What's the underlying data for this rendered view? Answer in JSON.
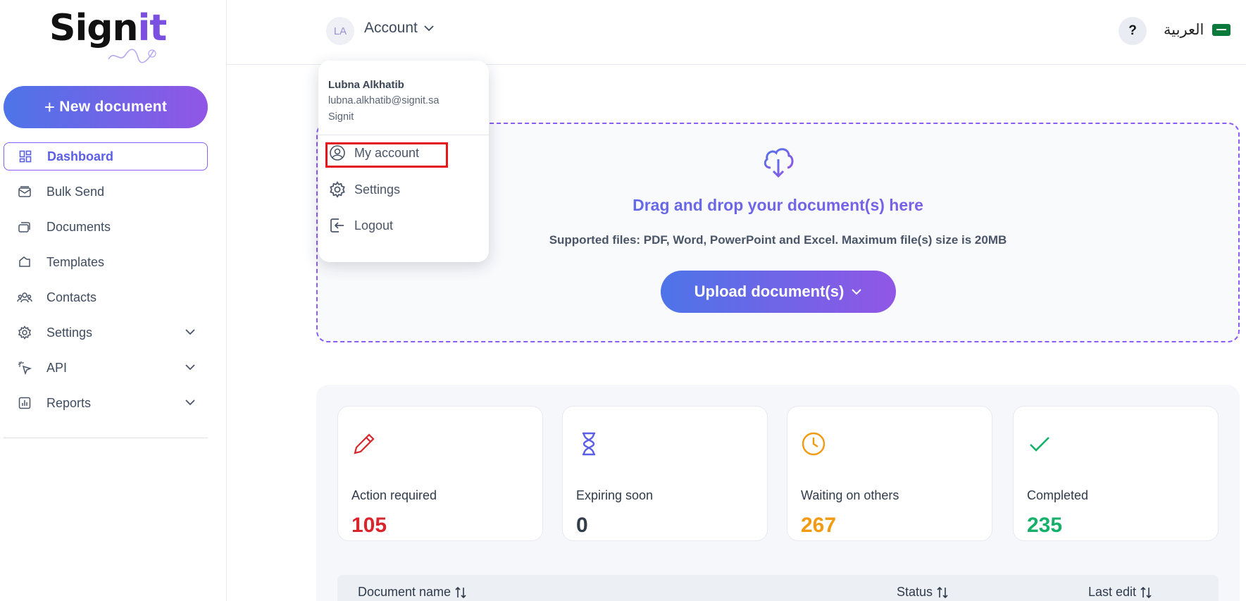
{
  "brand": {
    "logo_main": "Sign",
    "logo_accent": "it"
  },
  "sidebar": {
    "new_document_label": "New document",
    "items": [
      {
        "label": "Dashboard",
        "icon": "dashboard-icon",
        "active": true
      },
      {
        "label": "Bulk Send",
        "icon": "mail-stack-icon"
      },
      {
        "label": "Documents",
        "icon": "documents-icon"
      },
      {
        "label": "Templates",
        "icon": "template-icon"
      },
      {
        "label": "Contacts",
        "icon": "contacts-icon"
      },
      {
        "label": "Settings",
        "icon": "gear-icon",
        "expandable": true
      },
      {
        "label": "API",
        "icon": "cursor-click-icon",
        "expandable": true
      },
      {
        "label": "Reports",
        "icon": "bar-chart-icon",
        "expandable": true
      }
    ]
  },
  "header": {
    "avatar_initials": "LA",
    "account_label": "Account",
    "help_label": "?",
    "language_label": "العربية"
  },
  "account_menu": {
    "name": "Lubna Alkhatib",
    "email": "lubna.alkhatib@signit.sa",
    "organization": "Signit",
    "items": [
      {
        "label": "My account",
        "icon": "user-circle-icon"
      },
      {
        "label": "Settings",
        "icon": "gear-icon"
      },
      {
        "label": "Logout",
        "icon": "logout-icon"
      }
    ]
  },
  "dropzone": {
    "title": "Drag and drop your document(s) here",
    "subtitle": "Supported files: PDF, Word, PowerPoint and Excel. Maximum file(s) size is 20MB",
    "upload_label": "Upload document(s)"
  },
  "stats": [
    {
      "label": "Action required",
      "value": "105",
      "color": "#d9262c",
      "icon": "pencil-icon"
    },
    {
      "label": "Expiring soon",
      "value": "0",
      "color": "#333d4b",
      "icon": "hourglass-icon"
    },
    {
      "label": "Waiting on others",
      "value": "267",
      "color": "#f29a12",
      "icon": "clock-icon"
    },
    {
      "label": "Completed",
      "value": "235",
      "color": "#16b06a",
      "icon": "check-icon"
    }
  ],
  "table": {
    "columns": [
      "Document name",
      "Status",
      "Last edit"
    ]
  },
  "colors": {
    "accent_start": "#4d74e8",
    "accent_end": "#9156e6",
    "highlight": "#e4151b"
  }
}
